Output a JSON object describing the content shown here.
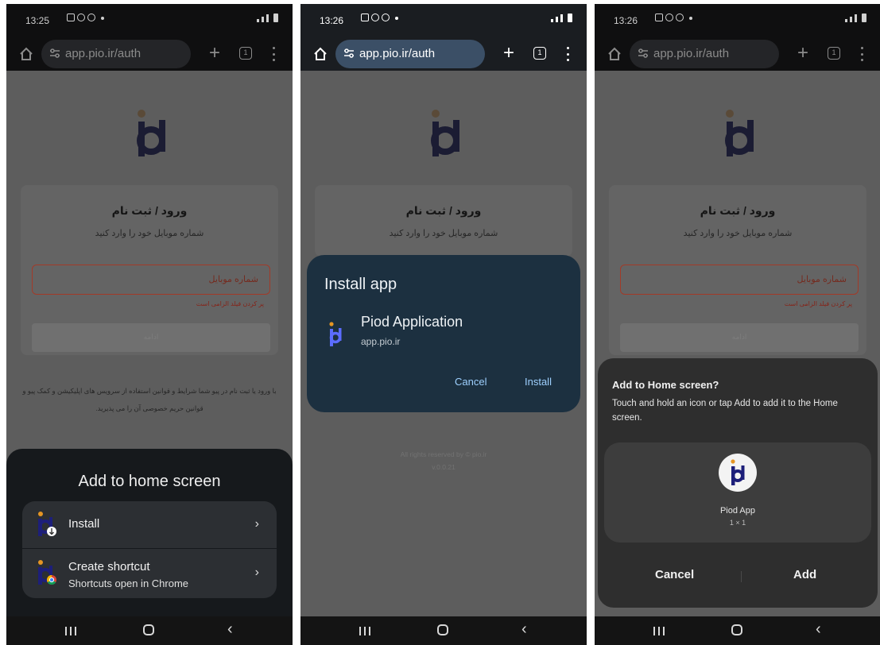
{
  "colors": {
    "logo_navy": "#1d1f7a",
    "logo_orange": "#e59523",
    "dialog_blue": "#1c3040",
    "link_blue": "#9ed0ff"
  },
  "screens": [
    {
      "status": {
        "time": "13:25"
      },
      "browser": {
        "url": "app.pio.ir/auth",
        "tab_count": "1",
        "new_tab_label": "+"
      },
      "page": {
        "title": "ورود / ثبت نام",
        "subtitle": "شماره موبایل خود را وارد کنید",
        "phone_placeholder": "شماره موبایل",
        "phone_error": "پر کردن فیلد الزامی است",
        "continue_label": "ادامه",
        "terms": "با ورود یا ثبت نام در پیو شما شرایط و قوانین استفاده از سرویس های اپلیکیشن و کمک پیو و قوانین حریم خصوصی آن را می پذیرید."
      },
      "sheet": {
        "title": "Add to home screen",
        "options": [
          {
            "label": "Install",
            "icon": "install-badge-icon"
          },
          {
            "label": "Create shortcut",
            "description": "Shortcuts open in Chrome",
            "icon": "chrome-badge-icon"
          }
        ]
      }
    },
    {
      "status": {
        "time": "13:26"
      },
      "browser": {
        "url": "app.pio.ir/auth",
        "tab_count": "1",
        "new_tab_label": "+"
      },
      "page": {
        "title": "ورود / ثبت نام",
        "subtitle": "شماره موبایل خود را وارد کنید",
        "footer_line1": "All rights reserved by © pio.ir",
        "footer_line2": "v.0.0.21"
      },
      "dialog": {
        "title": "Install app",
        "app_name": "Piod Application",
        "app_host": "app.pio.ir",
        "cancel_label": "Cancel",
        "install_label": "Install"
      }
    },
    {
      "status": {
        "time": "13:26"
      },
      "browser": {
        "url": "app.pio.ir/auth",
        "tab_count": "1",
        "new_tab_label": "+"
      },
      "page": {
        "title": "ورود / ثبت نام",
        "subtitle": "شماره موبایل خود را وارد کنید",
        "phone_placeholder": "شماره موبایل",
        "phone_error": "پر کردن فیلد الزامی است",
        "continue_label": "ادامه"
      },
      "sheet": {
        "title": "Add to Home screen?",
        "description": "Touch and hold an icon or tap Add to add it to the Home screen.",
        "app_name": "Piod App",
        "widget_size": "1 × 1",
        "cancel_label": "Cancel",
        "add_label": "Add"
      }
    }
  ]
}
